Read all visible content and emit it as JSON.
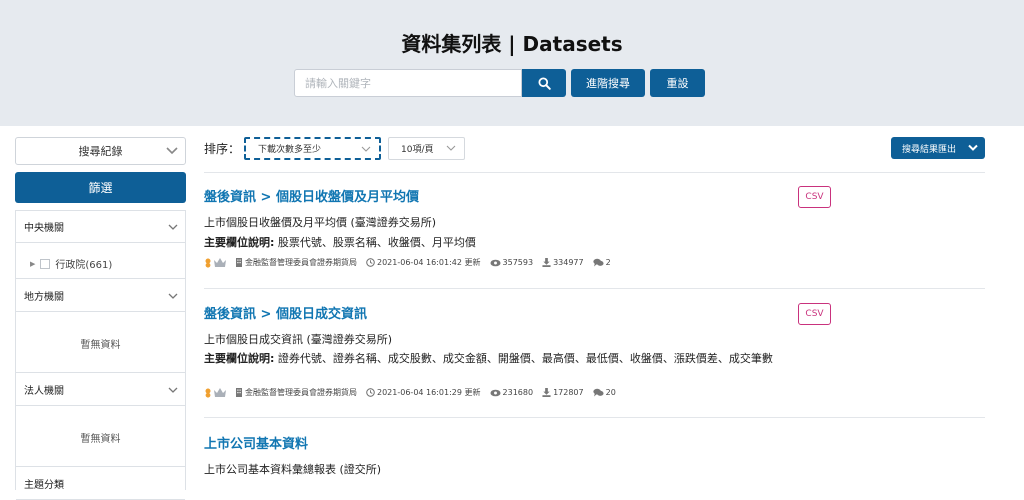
{
  "header": {
    "title": "資料集列表 | Datasets",
    "search_placeholder": "請輸入關鍵字",
    "advanced_search_label": "進階搜尋",
    "reset_label": "重設",
    "search_icon": "search-icon"
  },
  "sidebar": {
    "history_label": "搜尋紀錄",
    "filter_label": "篩選",
    "facets": [
      {
        "label": "中央機關",
        "items": [
          {
            "label": "行政院(661)"
          }
        ]
      },
      {
        "label": "地方機關",
        "empty_text": "暫無資料"
      },
      {
        "label": "法人機關",
        "empty_text": "暫無資料"
      },
      {
        "label": "主題分類"
      }
    ]
  },
  "toolbar": {
    "sort_label": "排序：",
    "sort_value": "下載次數多至少",
    "page_size_value": "10項/頁",
    "export_label": "搜尋結果匯出"
  },
  "results": [
    {
      "title": "盤後資訊 > 個股日收盤價及月平均價",
      "org": "上市個股日收盤價及月平均價 (臺灣證券交易所)",
      "fields_label": "主要欄位說明:",
      "fields": "股票代號、股票名稱、收盤價、月平均價",
      "agency": "金融監督管理委員會證券期貨局",
      "updated": "2021-06-04 16:01:42 更新",
      "views": "357593",
      "downloads": "334977",
      "comments": "2",
      "format": "CSV"
    },
    {
      "title": "盤後資訊 > 個股日成交資訊",
      "org": "上市個股日成交資訊 (臺灣證券交易所)",
      "fields_label": "主要欄位說明:",
      "fields": "證券代號、證券名稱、成交股數、成交金額、開盤價、最高價、最低價、收盤價、漲跌價差、成交筆數",
      "agency": "金融監督管理委員會證券期貨局",
      "updated": "2021-06-04 16:01:29 更新",
      "views": "231680",
      "downloads": "172807",
      "comments": "20",
      "format": "CSV"
    },
    {
      "title": "上市公司基本資料",
      "org": "上市公司基本資料彙總報表 (證交所)"
    }
  ],
  "colors": {
    "primary": "#0e5f97",
    "link": "#1176b2",
    "csv": "#c9327d",
    "header_bg": "#e6eaef"
  }
}
